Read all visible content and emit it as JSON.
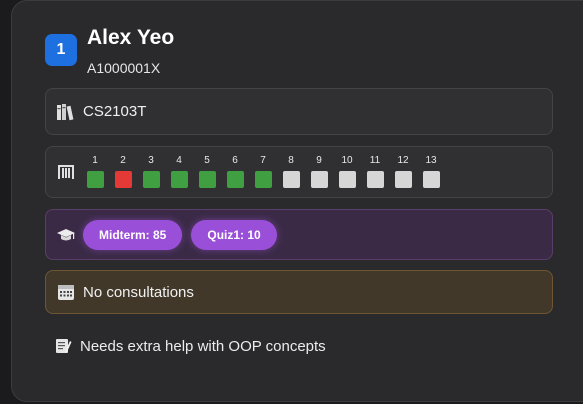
{
  "student": {
    "index": "1",
    "name": "Alex Yeo",
    "matric": "A1000001X"
  },
  "module": {
    "icon": "books-icon",
    "code": "CS2103T"
  },
  "attendance": {
    "icon": "abacus-icon",
    "weeks": [
      {
        "label": "1",
        "status": "present"
      },
      {
        "label": "2",
        "status": "absent"
      },
      {
        "label": "3",
        "status": "present"
      },
      {
        "label": "4",
        "status": "present"
      },
      {
        "label": "5",
        "status": "present"
      },
      {
        "label": "6",
        "status": "present"
      },
      {
        "label": "7",
        "status": "present"
      },
      {
        "label": "8",
        "status": "unmarked"
      },
      {
        "label": "9",
        "status": "unmarked"
      },
      {
        "label": "10",
        "status": "unmarked"
      },
      {
        "label": "11",
        "status": "unmarked"
      },
      {
        "label": "12",
        "status": "unmarked"
      },
      {
        "label": "13",
        "status": "unmarked"
      }
    ],
    "colors": {
      "present": "#3f9f41",
      "absent": "#e53935",
      "unmarked": "#d6d6d6"
    }
  },
  "grades": {
    "icon": "graduation-cap-icon",
    "items": [
      {
        "label": "Midterm: 85"
      },
      {
        "label": "Quiz1: 10"
      }
    ]
  },
  "consultations": {
    "icon": "calendar-icon",
    "text": "No consultations"
  },
  "note": {
    "icon": "memo-icon",
    "text": "Needs extra help with OOP concepts"
  },
  "colors": {
    "accent": "#1e6fe0",
    "grade_pill": "#9a4fd8",
    "card_bg": "#2a2a2c"
  }
}
